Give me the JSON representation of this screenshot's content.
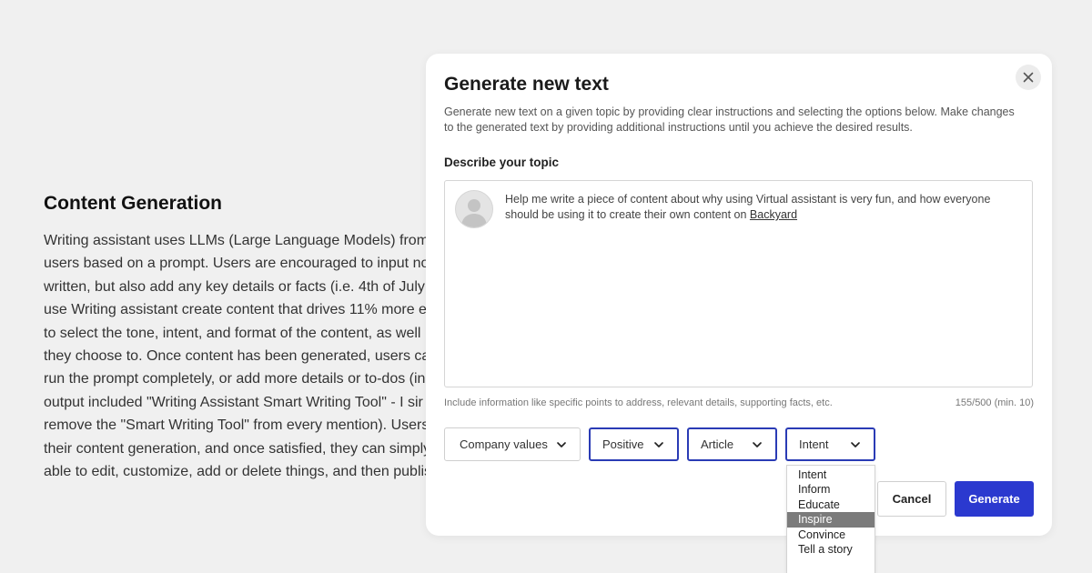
{
  "article": {
    "title": "Content Generation",
    "lines": [
      "Writing assistant uses LLMs (Large Language Models) from",
      "users based on a prompt. Users are encouraged to input no",
      "written, but also add any key details or facts (i.e. 4th of July",
      "use Writing assistant create content that drives 11% more e",
      "to select the tone, intent, and format of the content, as well",
      "they choose to. Once content has been generated, users ca",
      "run the prompt completely, or add more details or to-dos (in",
      "output included \"Writing Assistant Smart Writing Tool\" - I sir",
      "remove the \"Smart Writing Tool\" from every mention). Users",
      "their content generation, and once satisfied, they can simply",
      "able to edit, customize, add or delete things, and then publis"
    ]
  },
  "modal": {
    "title": "Generate new text",
    "description": "Generate new text on a given topic by providing clear instructions and selecting the options below. Make changes to the generated text by providing additional instructions until you achieve the desired results.",
    "topic_label": "Describe your topic",
    "topic_text": "Help me write a piece of content about why using Virtual assistant is very fun, and how everyone should be using it to create their own content on ",
    "topic_link": "Backyard",
    "hint": "Include information like specific points to address, relevant details, supporting facts, etc.",
    "counter": "155/500 (min. 10)",
    "selects": {
      "values": "Company values",
      "tone": "Positive",
      "format": "Article",
      "intent": "Intent"
    },
    "cancel_label": "Cancel",
    "generate_label": "Generate",
    "intent_options": [
      "Intent",
      "Inform",
      "Educate",
      "Inspire",
      "Convince",
      "Tell a story"
    ],
    "intent_highlighted": "Inspire"
  },
  "colors": {
    "accent": "#2b39cf",
    "select_active_border": "#2a3bb5",
    "highlight": "#7b7b7b",
    "page_background": "#f0f0f0"
  },
  "icons": {
    "close": "close-icon",
    "chevron": "chevron-down-icon",
    "avatar": "user-avatar-icon"
  }
}
